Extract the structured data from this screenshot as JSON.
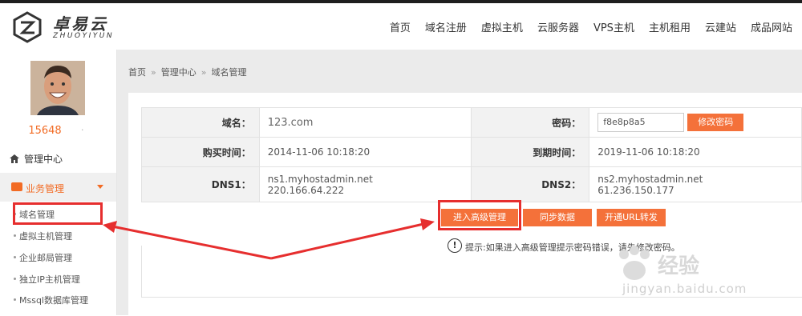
{
  "brand": {
    "name_cn": "卓易云",
    "name_en": "ZHUOYIYUN"
  },
  "nav": [
    "首页",
    "域名注册",
    "虚拟主机",
    "云服务器",
    "VPS主机",
    "主机租用",
    "云建站",
    "成品网站"
  ],
  "sidebar": {
    "user_id": "15648",
    "user_dot": "·",
    "home_label": "管理中心",
    "section_label": "业务管理",
    "items": [
      "域名管理",
      "虚拟主机管理",
      "企业邮局管理",
      "独立IP主机管理",
      "Mssql数据库管理"
    ]
  },
  "breadcrumb": [
    "首页",
    "管理中心",
    "域名管理"
  ],
  "domain_info": {
    "domain_label": "域名：",
    "domain_value": "123.com",
    "password_label": "密码：",
    "password_value": "f8e8p8a5",
    "change_password_button": "修改密码",
    "purchase_label": "购买时间：",
    "purchase_value": "2014-11-06 10:18:20",
    "expire_label": "到期时间：",
    "expire_value": "2019-11-06 10:18:20",
    "dns1_label": "DNS1：",
    "dns1_host": "ns1.myhostadmin.net",
    "dns1_ip": "220.166.64.222",
    "dns2_label": "DNS2：",
    "dns2_host": "ns2.myhostadmin.net",
    "dns2_ip": "61.236.150.177"
  },
  "actions": {
    "advanced_button": "进入高级管理",
    "sync_button": "同步数据",
    "url_forward_button": "开通URL转发",
    "hint": "提示:如果进入高级管理提示密码错误，请先修改密码。"
  },
  "watermark": {
    "text": "经验",
    "url": "jingyan.baidu.com"
  },
  "colors": {
    "accent": "#f4713a",
    "highlight": "#e62e2e",
    "sidebar_active": "#f26b24"
  }
}
